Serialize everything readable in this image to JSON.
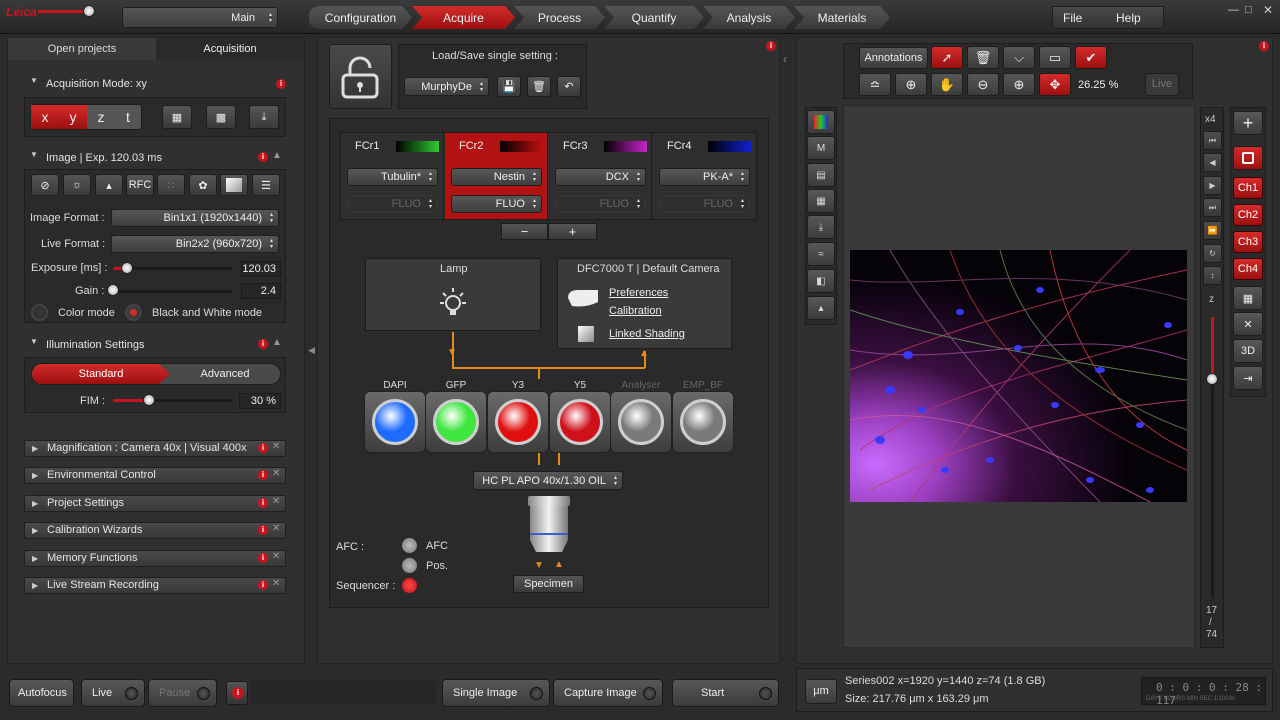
{
  "menu": {
    "main_label": "Main",
    "tabs": [
      "Configuration",
      "Acquire",
      "Process",
      "Quantify",
      "Analysis",
      "Materials"
    ],
    "active_tab": "Acquire",
    "right": [
      "File",
      "Help"
    ]
  },
  "left": {
    "tabs": [
      "Open projects",
      "Acquisition"
    ],
    "acq_mode": {
      "title": "Acquisition Mode: xy",
      "axes": [
        "x",
        "y",
        "z",
        "t"
      ]
    },
    "image": {
      "title": "Image | Exp. 120.03 ms",
      "rfc": "RFC",
      "format_label": "Image Format :",
      "format_value": "Bin1x1 (1920x1440)",
      "live_label": "Live Format :",
      "live_value": "Bin2x2 (960x720)",
      "exposure_label": "Exposure [ms] :",
      "exposure_value": "120.03",
      "exposure_frac": 0.12,
      "gain_label": "Gain :",
      "gain_value": "2.4",
      "gain_frac": 0.0,
      "color_mode": "Color mode",
      "bw_mode": "Black and White mode"
    },
    "illum": {
      "title": "Illumination Settings",
      "standard": "Standard",
      "advanced": "Advanced",
      "fim_label": "FIM :",
      "fim_value": "30 %",
      "fim_frac": 0.3
    },
    "sections": [
      "Magnification : Camera 40x | Visual 400x",
      "Environmental Control",
      "Project Settings",
      "Calibration Wizards",
      "Memory Functions",
      "Live Stream Recording"
    ]
  },
  "center": {
    "load_save_label": "Load/Save single setting :",
    "setting_value": "MurphyDe",
    "fc": [
      {
        "name": "FCr1",
        "color": "#2ecc2e",
        "marker": "Tubulin*",
        "mode": "FLUO"
      },
      {
        "name": "FCr2",
        "color": "#c01010",
        "marker": "Nestin",
        "mode": "FLUO"
      },
      {
        "name": "FCr3",
        "color": "#cc22cc",
        "marker": "DCX",
        "mode": "FLUO"
      },
      {
        "name": "FCr4",
        "color": "#1020d0",
        "marker": "PK-A*",
        "mode": "FLUO"
      }
    ],
    "minus": "−",
    "plus": "+",
    "lamp_title": "Lamp",
    "camera_title": "DFC7000 T | Default Camera",
    "camera_links": [
      "Preferences",
      "Calibration",
      "Linked Shading"
    ],
    "filters": [
      {
        "name": "DAPI",
        "color": "#1e6bff"
      },
      {
        "name": "GFP",
        "color": "#3ee63e"
      },
      {
        "name": "Y3",
        "color": "#e01010"
      },
      {
        "name": "Y5",
        "color": "#d0101a"
      },
      {
        "name": "Analyser",
        "color": "#7a7a7a"
      },
      {
        "name": "EMP_BF",
        "color": "#7a7a7a"
      }
    ],
    "objective": "HC PL APO   40x/1.30 OIL",
    "specimen": "Specimen",
    "afc_label": "AFC :",
    "afc": "AFC",
    "pos": "Pos.",
    "sequencer_label": "Sequencer :"
  },
  "viewer": {
    "annotations": "Annotations",
    "zoom": "26.25 %",
    "live": "Live",
    "x4": "x4",
    "z_label": "z",
    "z_pos": "17",
    "z_sep": "/",
    "z_total": "74",
    "z_frac": 0.22,
    "channels": [
      "Ch1",
      "Ch2",
      "Ch3",
      "Ch4"
    ],
    "three_d": "3D"
  },
  "bottom": {
    "autofocus": "Autofocus",
    "live": "Live",
    "pause": "Pause",
    "single": "Single Image",
    "capture": "Capture Image",
    "start": "Start",
    "unit": "μm",
    "series": "Series002 x=1920 y=1440 z=74  (1.8 GB)",
    "size": "Size: 217.76 μm x 163.29 μm",
    "timer": "0 : 0 : 0 : 28 : 117",
    "timer_labels": "DAYS HOURS  MIN  SEC  1/1000s"
  }
}
